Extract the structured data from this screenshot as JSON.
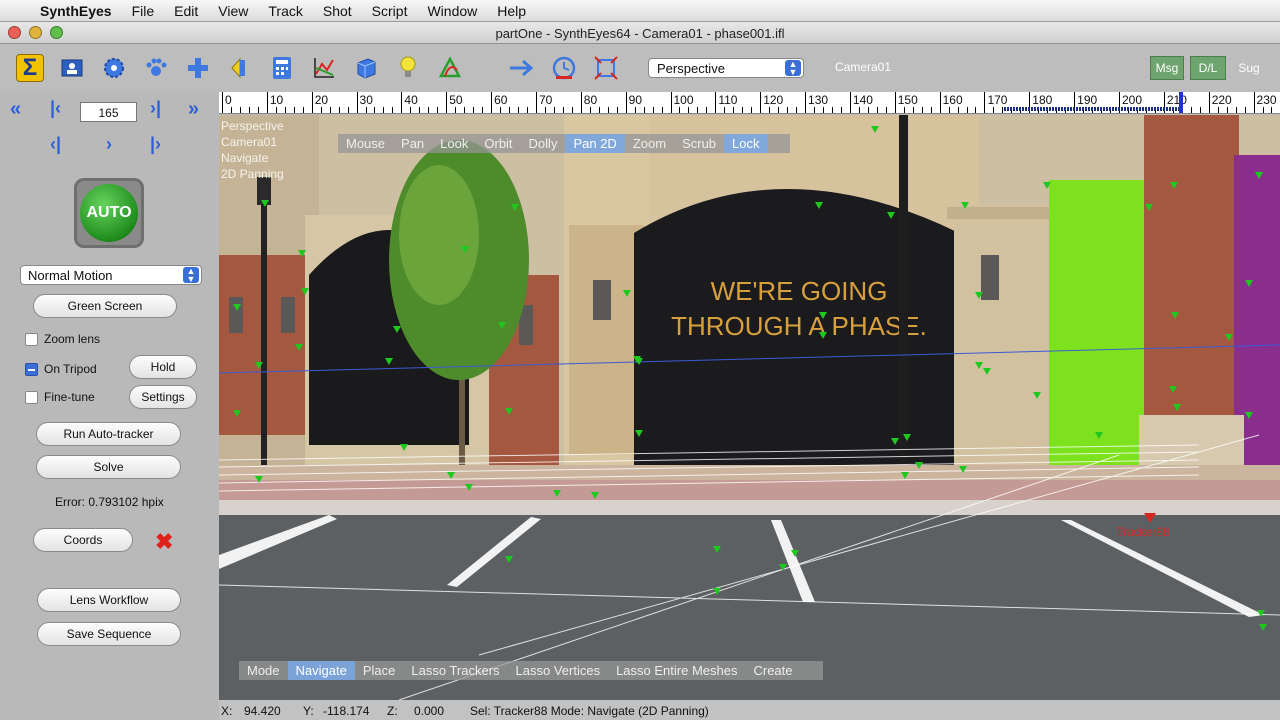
{
  "menubar": {
    "app_name": "SynthEyes",
    "menus": [
      "File",
      "Edit",
      "View",
      "Track",
      "Shot",
      "Script",
      "Window",
      "Help"
    ]
  },
  "window": {
    "title": "partOne - SynthEyes64 - Camera01 - phase001.ifl"
  },
  "toolbar": {
    "view_select": "Perspective",
    "camera_label": "Camera01",
    "msg_label": "Msg",
    "dl_label": "D/L",
    "sug_label": "Sug"
  },
  "left_panel": {
    "frame_value": "165",
    "auto_label": "AUTO",
    "motion_select": "Normal Motion",
    "green_screen": "Green Screen",
    "zoom_lens": "Zoom lens",
    "on_tripod": "On Tripod",
    "hold": "Hold",
    "fine_tune": "Fine-tune",
    "settings": "Settings",
    "run_auto_tracker": "Run Auto-tracker",
    "solve": "Solve",
    "error_text": "Error: 0.793102 hpix",
    "coords": "Coords",
    "lens_workflow": "Lens Workflow",
    "save_sequence": "Save Sequence",
    "checks": {
      "zoom_lens": false,
      "on_tripod": true,
      "fine_tune": false
    }
  },
  "timeline": {
    "labels": [
      "0",
      "10",
      "20",
      "30",
      "40",
      "50",
      "60",
      "70",
      "80",
      "90",
      "100",
      "110",
      "120",
      "130",
      "140",
      "150",
      "160",
      "170",
      "180",
      "190",
      "200",
      "210",
      "220",
      "230"
    ],
    "current_frame": 165
  },
  "viewport": {
    "overlay_lines": [
      "Perspective",
      "Camera01",
      "Navigate",
      "2D Panning"
    ],
    "top_modes": [
      "Mouse",
      "Pan",
      "Look",
      "Orbit",
      "Dolly",
      "Pan 2D",
      "Zoom",
      "Scrub",
      "Lock"
    ],
    "top_modes_selected": [
      "Pan 2D",
      "Lock"
    ],
    "bottom_modes": [
      "Mode",
      "Navigate",
      "Place",
      "Lasso Trackers",
      "Lasso Vertices",
      "Lasso Entire Meshes",
      "Create"
    ],
    "bottom_modes_selected": [
      "Navigate"
    ],
    "sign_line1": "WE'RE GOING",
    "sign_line2": "THROUGH A PHASE.",
    "tracker_label": "Tracker88"
  },
  "statusbar": {
    "x_label": "X:",
    "x_value": "94.420",
    "y_label": "Y:",
    "y_value": "-118.174",
    "z_label": "Z:",
    "z_value": "0.000",
    "sel": "Sel: Tracker88 Mode: Navigate (2D Panning)"
  },
  "colors": {
    "accent": "#3b6fd8",
    "tracker": "#1ec81e",
    "tracker_selected": "#d62820"
  }
}
